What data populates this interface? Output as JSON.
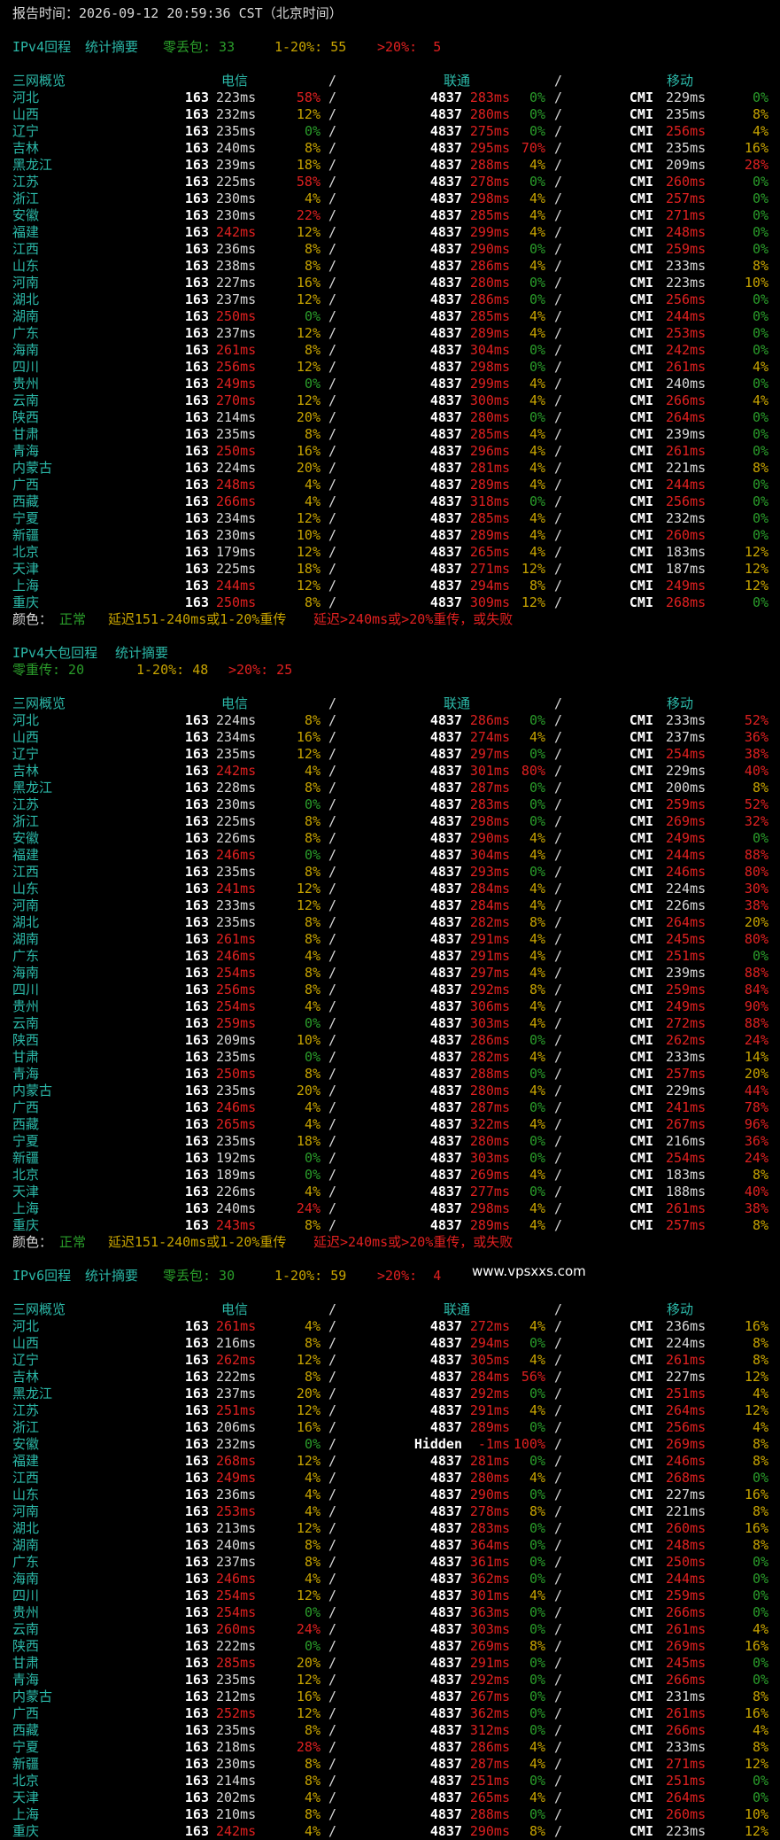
{
  "report": {
    "label": "报告时间：",
    "time": "2026-09-12 20:59:36 CST（北京时间）"
  },
  "headers": {
    "region": "三网概览",
    "telecom": "电信",
    "slash": "/",
    "unicom": "联通",
    "mobile": "移动"
  },
  "legend": {
    "label": "颜色：",
    "normal": "正常",
    "mid": "延迟151-240ms或1-20%重传",
    "bad": "延迟>240ms或>20%重传，或失败"
  },
  "watermark": "www.vpsxxs.com",
  "sections": [
    {
      "title": "IPv4回程",
      "summary_label": "统计摘要",
      "s0": "零丢包: 33",
      "s1": "1-20%: 55",
      "s2": ">20%:  5",
      "rows": [
        [
          "河北",
          "163",
          "223ms",
          "58%",
          "4837",
          "283ms",
          "0%",
          "CMI",
          "229ms",
          "0%"
        ],
        [
          "山西",
          "163",
          "232ms",
          "12%",
          "4837",
          "280ms",
          "0%",
          "CMI",
          "235ms",
          "8%"
        ],
        [
          "辽宁",
          "163",
          "235ms",
          "0%",
          "4837",
          "275ms",
          "0%",
          "CMI",
          "256ms",
          "4%"
        ],
        [
          "吉林",
          "163",
          "240ms",
          "8%",
          "4837",
          "295ms",
          "70%",
          "CMI",
          "235ms",
          "16%"
        ],
        [
          "黑龙江",
          "163",
          "239ms",
          "18%",
          "4837",
          "288ms",
          "4%",
          "CMI",
          "209ms",
          "28%"
        ],
        [
          "江苏",
          "163",
          "225ms",
          "58%",
          "4837",
          "278ms",
          "0%",
          "CMI",
          "260ms",
          "0%"
        ],
        [
          "浙江",
          "163",
          "230ms",
          "4%",
          "4837",
          "298ms",
          "4%",
          "CMI",
          "257ms",
          "0%"
        ],
        [
          "安徽",
          "163",
          "230ms",
          "22%",
          "4837",
          "285ms",
          "4%",
          "CMI",
          "271ms",
          "0%"
        ],
        [
          "福建",
          "163",
          "242ms",
          "12%",
          "4837",
          "299ms",
          "4%",
          "CMI",
          "248ms",
          "0%"
        ],
        [
          "江西",
          "163",
          "236ms",
          "8%",
          "4837",
          "290ms",
          "0%",
          "CMI",
          "259ms",
          "0%"
        ],
        [
          "山东",
          "163",
          "238ms",
          "8%",
          "4837",
          "286ms",
          "4%",
          "CMI",
          "233ms",
          "8%"
        ],
        [
          "河南",
          "163",
          "227ms",
          "16%",
          "4837",
          "280ms",
          "0%",
          "CMI",
          "223ms",
          "10%"
        ],
        [
          "湖北",
          "163",
          "237ms",
          "12%",
          "4837",
          "286ms",
          "0%",
          "CMI",
          "256ms",
          "0%"
        ],
        [
          "湖南",
          "163",
          "250ms",
          "0%",
          "4837",
          "285ms",
          "4%",
          "CMI",
          "244ms",
          "0%"
        ],
        [
          "广东",
          "163",
          "237ms",
          "12%",
          "4837",
          "289ms",
          "4%",
          "CMI",
          "253ms",
          "0%"
        ],
        [
          "海南",
          "163",
          "261ms",
          "8%",
          "4837",
          "304ms",
          "0%",
          "CMI",
          "242ms",
          "0%"
        ],
        [
          "四川",
          "163",
          "256ms",
          "12%",
          "4837",
          "298ms",
          "0%",
          "CMI",
          "261ms",
          "4%"
        ],
        [
          "贵州",
          "163",
          "249ms",
          "0%",
          "4837",
          "299ms",
          "4%",
          "CMI",
          "240ms",
          "0%"
        ],
        [
          "云南",
          "163",
          "270ms",
          "12%",
          "4837",
          "300ms",
          "4%",
          "CMI",
          "266ms",
          "4%"
        ],
        [
          "陕西",
          "163",
          "214ms",
          "20%",
          "4837",
          "280ms",
          "0%",
          "CMI",
          "264ms",
          "0%"
        ],
        [
          "甘肃",
          "163",
          "235ms",
          "8%",
          "4837",
          "285ms",
          "4%",
          "CMI",
          "239ms",
          "0%"
        ],
        [
          "青海",
          "163",
          "250ms",
          "16%",
          "4837",
          "296ms",
          "4%",
          "CMI",
          "261ms",
          "0%"
        ],
        [
          "内蒙古",
          "163",
          "224ms",
          "20%",
          "4837",
          "281ms",
          "4%",
          "CMI",
          "221ms",
          "8%"
        ],
        [
          "广西",
          "163",
          "248ms",
          "4%",
          "4837",
          "289ms",
          "4%",
          "CMI",
          "244ms",
          "0%"
        ],
        [
          "西藏",
          "163",
          "266ms",
          "4%",
          "4837",
          "318ms",
          "0%",
          "CMI",
          "256ms",
          "0%"
        ],
        [
          "宁夏",
          "163",
          "234ms",
          "12%",
          "4837",
          "285ms",
          "4%",
          "CMI",
          "232ms",
          "0%"
        ],
        [
          "新疆",
          "163",
          "230ms",
          "10%",
          "4837",
          "289ms",
          "4%",
          "CMI",
          "260ms",
          "0%"
        ],
        [
          "北京",
          "163",
          "179ms",
          "12%",
          "4837",
          "265ms",
          "4%",
          "CMI",
          "183ms",
          "12%"
        ],
        [
          "天津",
          "163",
          "225ms",
          "18%",
          "4837",
          "271ms",
          "12%",
          "CMI",
          "187ms",
          "12%"
        ],
        [
          "上海",
          "163",
          "244ms",
          "12%",
          "4837",
          "294ms",
          "8%",
          "CMI",
          "249ms",
          "12%"
        ],
        [
          "重庆",
          "163",
          "250ms",
          "8%",
          "4837",
          "309ms",
          "12%",
          "CMI",
          "268ms",
          "0%"
        ]
      ]
    },
    {
      "title": "IPv4大包回程",
      "summary_label": "统计摘要",
      "s0": "零重传: 20",
      "s1": "1-20%: 48",
      "s2": ">20%: 25",
      "rows": [
        [
          "河北",
          "163",
          "224ms",
          "8%",
          "4837",
          "286ms",
          "0%",
          "CMI",
          "233ms",
          "52%"
        ],
        [
          "山西",
          "163",
          "234ms",
          "16%",
          "4837",
          "274ms",
          "4%",
          "CMI",
          "237ms",
          "36%"
        ],
        [
          "辽宁",
          "163",
          "235ms",
          "12%",
          "4837",
          "297ms",
          "0%",
          "CMI",
          "254ms",
          "38%"
        ],
        [
          "吉林",
          "163",
          "242ms",
          "4%",
          "4837",
          "301ms",
          "80%",
          "CMI",
          "229ms",
          "40%"
        ],
        [
          "黑龙江",
          "163",
          "228ms",
          "8%",
          "4837",
          "287ms",
          "0%",
          "CMI",
          "200ms",
          "8%"
        ],
        [
          "江苏",
          "163",
          "230ms",
          "0%",
          "4837",
          "283ms",
          "0%",
          "CMI",
          "259ms",
          "52%"
        ],
        [
          "浙江",
          "163",
          "225ms",
          "8%",
          "4837",
          "298ms",
          "0%",
          "CMI",
          "269ms",
          "32%"
        ],
        [
          "安徽",
          "163",
          "226ms",
          "8%",
          "4837",
          "290ms",
          "4%",
          "CMI",
          "249ms",
          "0%"
        ],
        [
          "福建",
          "163",
          "246ms",
          "0%",
          "4837",
          "304ms",
          "4%",
          "CMI",
          "244ms",
          "88%"
        ],
        [
          "江西",
          "163",
          "235ms",
          "8%",
          "4837",
          "293ms",
          "0%",
          "CMI",
          "246ms",
          "80%"
        ],
        [
          "山东",
          "163",
          "241ms",
          "12%",
          "4837",
          "284ms",
          "4%",
          "CMI",
          "224ms",
          "30%"
        ],
        [
          "河南",
          "163",
          "233ms",
          "12%",
          "4837",
          "284ms",
          "4%",
          "CMI",
          "226ms",
          "38%"
        ],
        [
          "湖北",
          "163",
          "235ms",
          "8%",
          "4837",
          "282ms",
          "8%",
          "CMI",
          "264ms",
          "20%"
        ],
        [
          "湖南",
          "163",
          "261ms",
          "8%",
          "4837",
          "291ms",
          "4%",
          "CMI",
          "245ms",
          "80%"
        ],
        [
          "广东",
          "163",
          "246ms",
          "4%",
          "4837",
          "291ms",
          "4%",
          "CMI",
          "251ms",
          "0%"
        ],
        [
          "海南",
          "163",
          "254ms",
          "8%",
          "4837",
          "297ms",
          "4%",
          "CMI",
          "239ms",
          "88%"
        ],
        [
          "四川",
          "163",
          "256ms",
          "8%",
          "4837",
          "292ms",
          "8%",
          "CMI",
          "259ms",
          "84%"
        ],
        [
          "贵州",
          "163",
          "254ms",
          "4%",
          "4837",
          "306ms",
          "4%",
          "CMI",
          "249ms",
          "90%"
        ],
        [
          "云南",
          "163",
          "259ms",
          "0%",
          "4837",
          "303ms",
          "4%",
          "CMI",
          "272ms",
          "88%"
        ],
        [
          "陕西",
          "163",
          "209ms",
          "10%",
          "4837",
          "286ms",
          "0%",
          "CMI",
          "262ms",
          "24%"
        ],
        [
          "甘肃",
          "163",
          "235ms",
          "0%",
          "4837",
          "282ms",
          "4%",
          "CMI",
          "233ms",
          "14%"
        ],
        [
          "青海",
          "163",
          "250ms",
          "8%",
          "4837",
          "288ms",
          "0%",
          "CMI",
          "257ms",
          "20%"
        ],
        [
          "内蒙古",
          "163",
          "235ms",
          "20%",
          "4837",
          "280ms",
          "4%",
          "CMI",
          "229ms",
          "44%"
        ],
        [
          "广西",
          "163",
          "246ms",
          "4%",
          "4837",
          "287ms",
          "0%",
          "CMI",
          "241ms",
          "78%"
        ],
        [
          "西藏",
          "163",
          "265ms",
          "4%",
          "4837",
          "322ms",
          "4%",
          "CMI",
          "267ms",
          "96%"
        ],
        [
          "宁夏",
          "163",
          "235ms",
          "18%",
          "4837",
          "280ms",
          "0%",
          "CMI",
          "216ms",
          "36%"
        ],
        [
          "新疆",
          "163",
          "192ms",
          "0%",
          "4837",
          "303ms",
          "0%",
          "CMI",
          "254ms",
          "24%"
        ],
        [
          "北京",
          "163",
          "189ms",
          "0%",
          "4837",
          "269ms",
          "4%",
          "CMI",
          "183ms",
          "8%"
        ],
        [
          "天津",
          "163",
          "226ms",
          "4%",
          "4837",
          "277ms",
          "0%",
          "CMI",
          "188ms",
          "40%"
        ],
        [
          "上海",
          "163",
          "240ms",
          "24%",
          "4837",
          "298ms",
          "4%",
          "CMI",
          "261ms",
          "38%"
        ],
        [
          "重庆",
          "163",
          "243ms",
          "8%",
          "4837",
          "289ms",
          "4%",
          "CMI",
          "257ms",
          "8%"
        ]
      ]
    },
    {
      "title": "IPv6回程",
      "summary_label": "统计摘要",
      "s0": "零丢包: 30",
      "s1": "1-20%: 59",
      "s2": ">20%:  4",
      "rows": [
        [
          "河北",
          "163",
          "261ms",
          "4%",
          "4837",
          "272ms",
          "4%",
          "CMI",
          "236ms",
          "16%"
        ],
        [
          "山西",
          "163",
          "216ms",
          "8%",
          "4837",
          "294ms",
          "0%",
          "CMI",
          "224ms",
          "8%"
        ],
        [
          "辽宁",
          "163",
          "262ms",
          "12%",
          "4837",
          "305ms",
          "4%",
          "CMI",
          "261ms",
          "8%"
        ],
        [
          "吉林",
          "163",
          "222ms",
          "8%",
          "4837",
          "284ms",
          "56%",
          "CMI",
          "227ms",
          "12%"
        ],
        [
          "黑龙江",
          "163",
          "237ms",
          "20%",
          "4837",
          "292ms",
          "0%",
          "CMI",
          "251ms",
          "4%"
        ],
        [
          "江苏",
          "163",
          "251ms",
          "12%",
          "4837",
          "291ms",
          "4%",
          "CMI",
          "264ms",
          "12%"
        ],
        [
          "浙江",
          "163",
          "206ms",
          "16%",
          "4837",
          "289ms",
          "0%",
          "CMI",
          "256ms",
          "4%"
        ],
        [
          "安徽",
          "163",
          "232ms",
          "0%",
          "Hidden",
          "-1ms",
          "100%",
          "CMI",
          "269ms",
          "8%"
        ],
        [
          "福建",
          "163",
          "268ms",
          "12%",
          "4837",
          "281ms",
          "0%",
          "CMI",
          "246ms",
          "8%"
        ],
        [
          "江西",
          "163",
          "249ms",
          "4%",
          "4837",
          "280ms",
          "4%",
          "CMI",
          "268ms",
          "0%"
        ],
        [
          "山东",
          "163",
          "236ms",
          "4%",
          "4837",
          "290ms",
          "0%",
          "CMI",
          "227ms",
          "16%"
        ],
        [
          "河南",
          "163",
          "253ms",
          "4%",
          "4837",
          "278ms",
          "8%",
          "CMI",
          "221ms",
          "8%"
        ],
        [
          "湖北",
          "163",
          "213ms",
          "12%",
          "4837",
          "283ms",
          "0%",
          "CMI",
          "260ms",
          "16%"
        ],
        [
          "湖南",
          "163",
          "240ms",
          "8%",
          "4837",
          "364ms",
          "0%",
          "CMI",
          "248ms",
          "8%"
        ],
        [
          "广东",
          "163",
          "237ms",
          "8%",
          "4837",
          "361ms",
          "0%",
          "CMI",
          "250ms",
          "0%"
        ],
        [
          "海南",
          "163",
          "246ms",
          "4%",
          "4837",
          "362ms",
          "0%",
          "CMI",
          "244ms",
          "0%"
        ],
        [
          "四川",
          "163",
          "254ms",
          "12%",
          "4837",
          "301ms",
          "4%",
          "CMI",
          "259ms",
          "0%"
        ],
        [
          "贵州",
          "163",
          "254ms",
          "0%",
          "4837",
          "363ms",
          "0%",
          "CMI",
          "266ms",
          "0%"
        ],
        [
          "云南",
          "163",
          "260ms",
          "24%",
          "4837",
          "303ms",
          "0%",
          "CMI",
          "261ms",
          "4%"
        ],
        [
          "陕西",
          "163",
          "222ms",
          "0%",
          "4837",
          "269ms",
          "8%",
          "CMI",
          "269ms",
          "16%"
        ],
        [
          "甘肃",
          "163",
          "285ms",
          "20%",
          "4837",
          "291ms",
          "0%",
          "CMI",
          "245ms",
          "0%"
        ],
        [
          "青海",
          "163",
          "235ms",
          "12%",
          "4837",
          "292ms",
          "0%",
          "CMI",
          "266ms",
          "0%"
        ],
        [
          "内蒙古",
          "163",
          "212ms",
          "16%",
          "4837",
          "267ms",
          "0%",
          "CMI",
          "231ms",
          "8%"
        ],
        [
          "广西",
          "163",
          "252ms",
          "12%",
          "4837",
          "362ms",
          "0%",
          "CMI",
          "261ms",
          "16%"
        ],
        [
          "西藏",
          "163",
          "235ms",
          "8%",
          "4837",
          "312ms",
          "0%",
          "CMI",
          "266ms",
          "4%"
        ],
        [
          "宁夏",
          "163",
          "218ms",
          "28%",
          "4837",
          "286ms",
          "4%",
          "CMI",
          "233ms",
          "8%"
        ],
        [
          "新疆",
          "163",
          "230ms",
          "8%",
          "4837",
          "287ms",
          "4%",
          "CMI",
          "271ms",
          "12%"
        ],
        [
          "北京",
          "163",
          "214ms",
          "8%",
          "4837",
          "251ms",
          "0%",
          "CMI",
          "251ms",
          "0%"
        ],
        [
          "天津",
          "163",
          "202ms",
          "4%",
          "4837",
          "265ms",
          "4%",
          "CMI",
          "264ms",
          "0%"
        ],
        [
          "上海",
          "163",
          "210ms",
          "8%",
          "4837",
          "288ms",
          "0%",
          "CMI",
          "260ms",
          "10%"
        ],
        [
          "重庆",
          "163",
          "242ms",
          "4%",
          "4837",
          "290ms",
          "8%",
          "CMI",
          "223ms",
          "12%"
        ]
      ]
    }
  ]
}
